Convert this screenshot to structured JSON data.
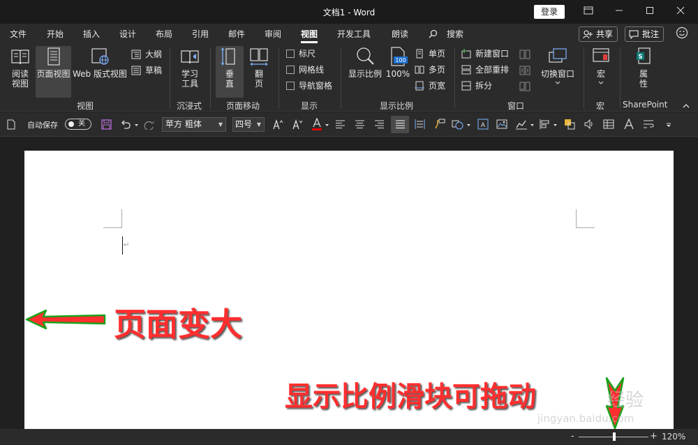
{
  "titlebar": {
    "title": "文档1  -  Word",
    "login": "登录",
    "ribbon_display_icon": "ribbon-display-icon",
    "minimize_icon": "minimize-icon",
    "maximize_icon": "maximize-icon",
    "close_icon": "close-icon"
  },
  "menu": {
    "tabs": [
      "文件",
      "开始",
      "插入",
      "设计",
      "布局",
      "引用",
      "邮件",
      "审阅",
      "视图",
      "开发工具",
      "朗读",
      "搜索"
    ],
    "active_tab": "视图",
    "share": "共享",
    "comments": "批注"
  },
  "ribbon": {
    "views": {
      "read": "阅读\n视图",
      "print": "页面视图",
      "web": "Web 版式视图",
      "outline": "大纲",
      "draft": "草稿",
      "label": "视图"
    },
    "immersive": {
      "learning": "学习\n工具",
      "label": "沉浸式"
    },
    "page_movement": {
      "vertical": "垂\n直",
      "side": "翻\n页",
      "label": "页面移动"
    },
    "show": {
      "ruler": "标尺",
      "gridlines": "网格线",
      "nav_pane": "导航窗格",
      "label": "显示"
    },
    "zoom": {
      "zoom": "显示比例",
      "hundred": "100%",
      "one_page": "单页",
      "multi_page": "多页",
      "page_width": "页宽",
      "label": "显示比例",
      "hundred_badge": "100"
    },
    "window": {
      "new_window": "新建窗口",
      "arrange_all": "全部重排",
      "split": "拆分",
      "switch_windows": "切换窗口",
      "label": "窗口"
    },
    "macros": {
      "macros": "宏",
      "label": "宏"
    },
    "sharepoint": {
      "properties": "属\n性",
      "label": "SharePoint"
    }
  },
  "qat": {
    "autosave": "自动保存",
    "toggle": "关",
    "font": "苹方 粗体",
    "size": "四号"
  },
  "document": {
    "paragraph_mark": "↵"
  },
  "annotations": {
    "page_bigger": "页面变大",
    "zoom_slider_drag": "显示比例滑块可拖动"
  },
  "watermark": {
    "brand": "经验",
    "url": "jingyan.baidu.com"
  },
  "statusbar": {
    "zoom_minus": "-",
    "zoom_plus": "+",
    "zoom_percent": "120%"
  },
  "colors": {
    "accent_red": "#ff2f2f",
    "arrow_green": "#1aa31a",
    "ribbon_bg": "#2b2b2b",
    "title_bg": "#1b1b1b"
  }
}
